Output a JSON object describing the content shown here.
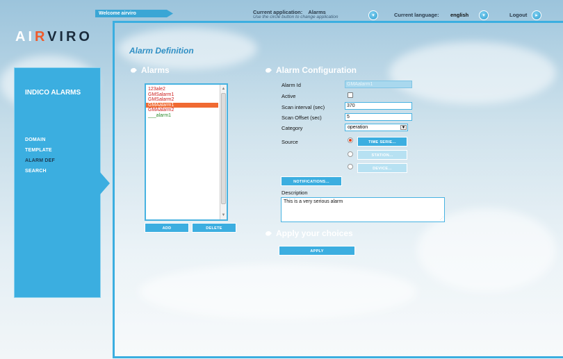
{
  "header": {
    "welcome": "Welcome airviro",
    "current_application_label": "Current application:",
    "current_application_value": "Alarms",
    "current_application_hint": "Use the circle button to change application",
    "current_language_label": "Current language:",
    "current_language_value": "english",
    "logout_label": "Logout"
  },
  "logo": {
    "part1": "AI",
    "part2": "R",
    "part3": "VIRO"
  },
  "sidebar": {
    "title": "INDICO ALARMS",
    "items": [
      {
        "label": "DOMAIN",
        "active": false
      },
      {
        "label": "TEMPLATE",
        "active": false
      },
      {
        "label": "ALARM DEF",
        "active": true
      },
      {
        "label": "SEARCH",
        "active": false
      }
    ]
  },
  "page": {
    "title": "Alarm Definition",
    "alarms_heading": "Alarms",
    "config_heading": "Alarm Configuration",
    "apply_heading": "Apply your choices"
  },
  "alarms": {
    "items": [
      {
        "label": "123ale2",
        "selected": false,
        "color": "red"
      },
      {
        "label": "GMSalarm1",
        "selected": false,
        "color": "red"
      },
      {
        "label": "GMSalarm2",
        "selected": false,
        "color": "red"
      },
      {
        "label": "GMAalarm1",
        "selected": true,
        "color": "red"
      },
      {
        "label": "GMAalarm2",
        "selected": false,
        "color": "red"
      },
      {
        "label": "___alarm1",
        "selected": false,
        "color": "green"
      }
    ],
    "add_label": "ADD",
    "delete_label": "DELETE"
  },
  "form": {
    "alarm_id_label": "Alarm Id",
    "alarm_id_value": "GMAalarm1",
    "active_label": "Active",
    "scan_interval_label": "Scan interval (sec)",
    "scan_interval_value": "370",
    "scan_offset_label": "Scan Offset (sec)",
    "scan_offset_value": "5",
    "category_label": "Category",
    "category_value": "operation",
    "source_label": "Source",
    "source_options": [
      "TIME SERIE...",
      "STATION...",
      "DEVICE..."
    ],
    "source_selected": 0,
    "notifications_label": "NOTIFICATIONS...",
    "description_label": "Description",
    "description_value": "This is a very serious alarm",
    "apply_label": "APPLY"
  },
  "colors": {
    "accent": "#3baee0",
    "selected_row": "#f06a32",
    "alarm_text": "#cc1b1b",
    "title": "#2f8fc4"
  }
}
